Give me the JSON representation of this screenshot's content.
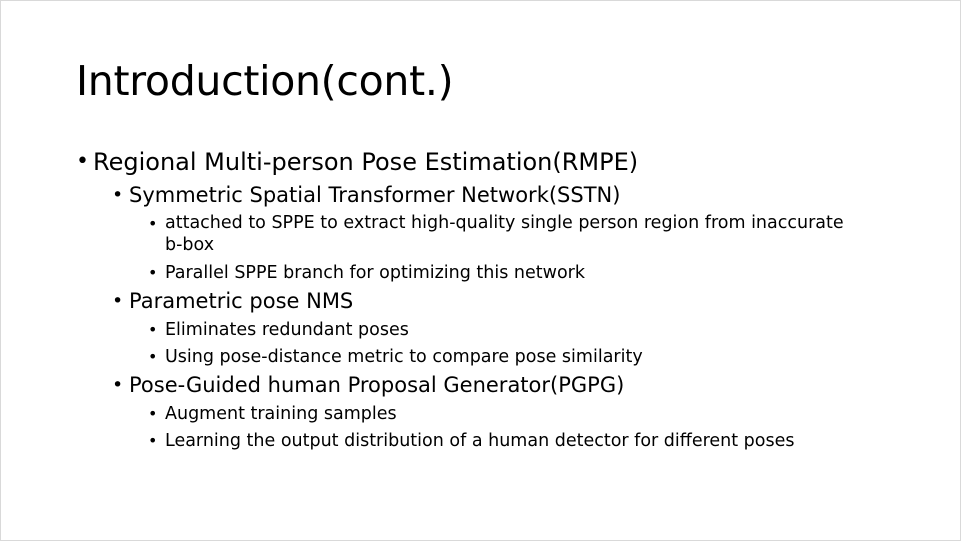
{
  "slide": {
    "title": "Introduction(cont.)",
    "bullet_glyph": "•",
    "items": [
      {
        "level": 1,
        "text": "Regional Multi-person Pose Estimation(RMPE)"
      },
      {
        "level": 2,
        "text": "Symmetric Spatial Transformer Network(SSTN)"
      },
      {
        "level": 3,
        "lines": [
          "attached to SPPE to extract high-quality single person region from inaccurate",
          "b-box"
        ]
      },
      {
        "level": 3,
        "text": "Parallel SPPE branch for optimizing this network"
      },
      {
        "level": 2,
        "text": "Parametric pose NMS"
      },
      {
        "level": 3,
        "text": "Eliminates redundant poses"
      },
      {
        "level": 3,
        "text": "Using pose-distance metric to compare pose similarity"
      },
      {
        "level": 2,
        "text": "Pose-Guided human Proposal Generator(PGPG)"
      },
      {
        "level": 3,
        "text": "Augment training samples"
      },
      {
        "level": 3,
        "text": "Learning the output distribution of a human detector for different poses"
      }
    ]
  }
}
